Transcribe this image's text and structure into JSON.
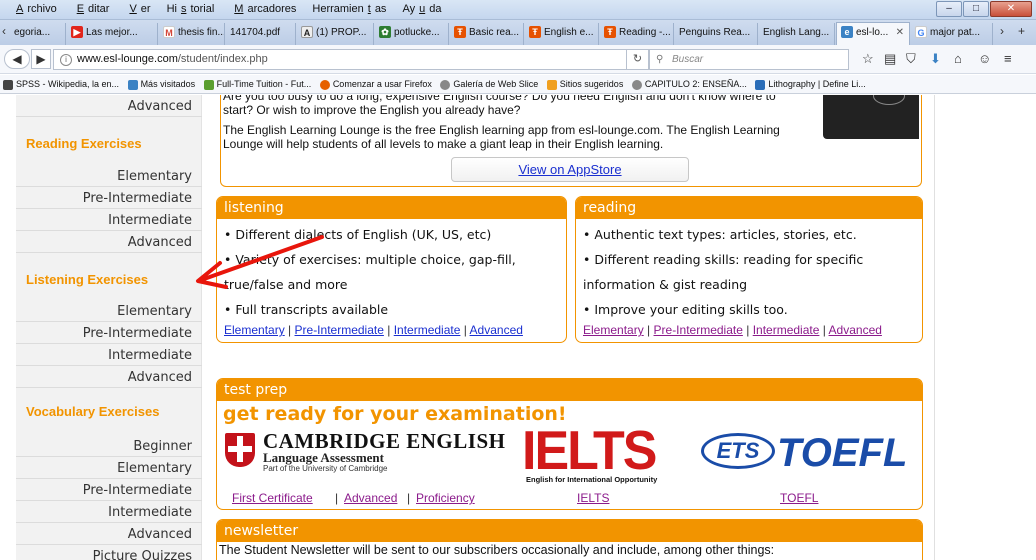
{
  "browser": {
    "menu": [
      {
        "pre": "",
        "key": "A",
        "post": "rchivo"
      },
      {
        "pre": "",
        "key": "E",
        "post": "ditar"
      },
      {
        "pre": "",
        "key": "V",
        "post": "er"
      },
      {
        "pre": "Hi",
        "key": "s",
        "post": "torial"
      },
      {
        "pre": "",
        "key": "M",
        "post": "arcadores"
      },
      {
        "pre": "Herramien",
        "key": "t",
        "post": "as"
      },
      {
        "pre": "Ay",
        "key": "u",
        "post": "da"
      }
    ],
    "window_buttons": [
      "–",
      "□",
      "✕"
    ],
    "tabs": [
      {
        "label": "egoria...",
        "color": "#777777"
      },
      {
        "label": "Las mejor...",
        "color": "#e1251b"
      },
      {
        "label": "thesis fin...",
        "color": "#d44638"
      },
      {
        "label": "141704.pdf",
        "color": ""
      },
      {
        "label": "(1) PROP...",
        "color": "#222222"
      },
      {
        "label": "potlucke...",
        "color": "#2e7d32"
      },
      {
        "label": "Basic rea...",
        "color": "#e65100"
      },
      {
        "label": "English e...",
        "color": "#e65100"
      },
      {
        "label": "Reading -...",
        "color": "#e65100"
      },
      {
        "label": "Penguins Rea...",
        "color": ""
      },
      {
        "label": "English Lang...",
        "color": ""
      },
      {
        "label": "esl-lo...",
        "color": "#3b82c4"
      },
      {
        "label": "major pat...",
        "color": "#4285f4"
      }
    ],
    "url_host": "www.esl-lounge.com",
    "url_path": "/student/index.php",
    "search_placeholder": "Buscar",
    "bookmarks": [
      {
        "label": "SPSS - Wikipedia, la en...",
        "color": "#444444"
      },
      {
        "label": "Más visitados",
        "color": "#3b82c4"
      },
      {
        "label": "Full-Time Tuition - Fut...",
        "color": "#5a9e2f"
      },
      {
        "label": "Comenzar a usar Firefox",
        "color": "#e66000"
      },
      {
        "label": "Galería de Web Slice",
        "color": "#888888"
      },
      {
        "label": "Sitios sugeridos",
        "color": "#f0a020"
      },
      {
        "label": "CAPITULO 2: ENSEÑA...",
        "color": "#888888"
      },
      {
        "label": "Lithography | Define Li...",
        "color": "#2a6db8"
      }
    ]
  },
  "sidebar": {
    "top_item": "Advanced",
    "sections": [
      {
        "title": "Reading Exercises",
        "items": [
          "Elementary",
          "Pre-Intermediate",
          "Intermediate",
          "Advanced"
        ]
      },
      {
        "title": "Listening Exercises",
        "items": [
          "Elementary",
          "Pre-Intermediate",
          "Intermediate",
          "Advanced"
        ]
      },
      {
        "title": "Vocabulary Exercises",
        "items": [
          "Beginner",
          "Elementary",
          "Pre-Intermediate",
          "Intermediate",
          "Advanced",
          "Picture Quizzes"
        ]
      }
    ]
  },
  "intro": {
    "line1": "Are you too busy to do a long, expensive English course? Do you need English and don't know where to",
    "line2": "start? Or wish to improve the English you already have?",
    "line3": "The English Learning Lounge is the free English learning app from esl-lounge.com. The English Learning",
    "line4": "Lounge will help students of all levels to make a giant leap in their English learning.",
    "app_button": "View on AppStore"
  },
  "listening": {
    "title": "listening",
    "bullets": [
      "• Different dialects of English (UK, US, etc)",
      "• Variety of exercises: multiple choice, gap-fill,",
      "true/false and more",
      "• Full transcripts available"
    ],
    "links": [
      "Elementary",
      "Pre-Intermediate",
      "Intermediate",
      "Advanced"
    ],
    "sep": "|"
  },
  "reading": {
    "title": "reading",
    "bullets": [
      "• Authentic text types: articles, stories, etc.",
      "• Different reading skills: reading for specific",
      "information & gist reading",
      "• Improve your editing skills too."
    ],
    "links": [
      "Elementary",
      "Pre-Intermediate",
      "Intermediate",
      "Advanced"
    ],
    "sep": "|"
  },
  "testprep": {
    "title": "test prep",
    "headline": "get ready for your examination!",
    "cambridge_title": "CAMBRIDGE ENGLISH",
    "cambridge_sub": "Language Assessment",
    "cambridge_sub2": "Part of the University of Cambridge",
    "ielts_logo": "IELTS",
    "ielts_sub": "English for International Opportunity",
    "ets_logo": "ETS",
    "toefl_logo": "TOEFL",
    "links": {
      "fc": "First Certificate",
      "adv": "Advanced",
      "prof": "Proficiency",
      "ielts": "IELTS",
      "toefl": "TOEFL"
    },
    "sep": "|"
  },
  "newsletter": {
    "title": "newsletter",
    "text": "The Student Newsletter will be sent to our subscribers occasionally and include, among other things:"
  },
  "annotation": {
    "arrow_color": "#e8160c"
  }
}
